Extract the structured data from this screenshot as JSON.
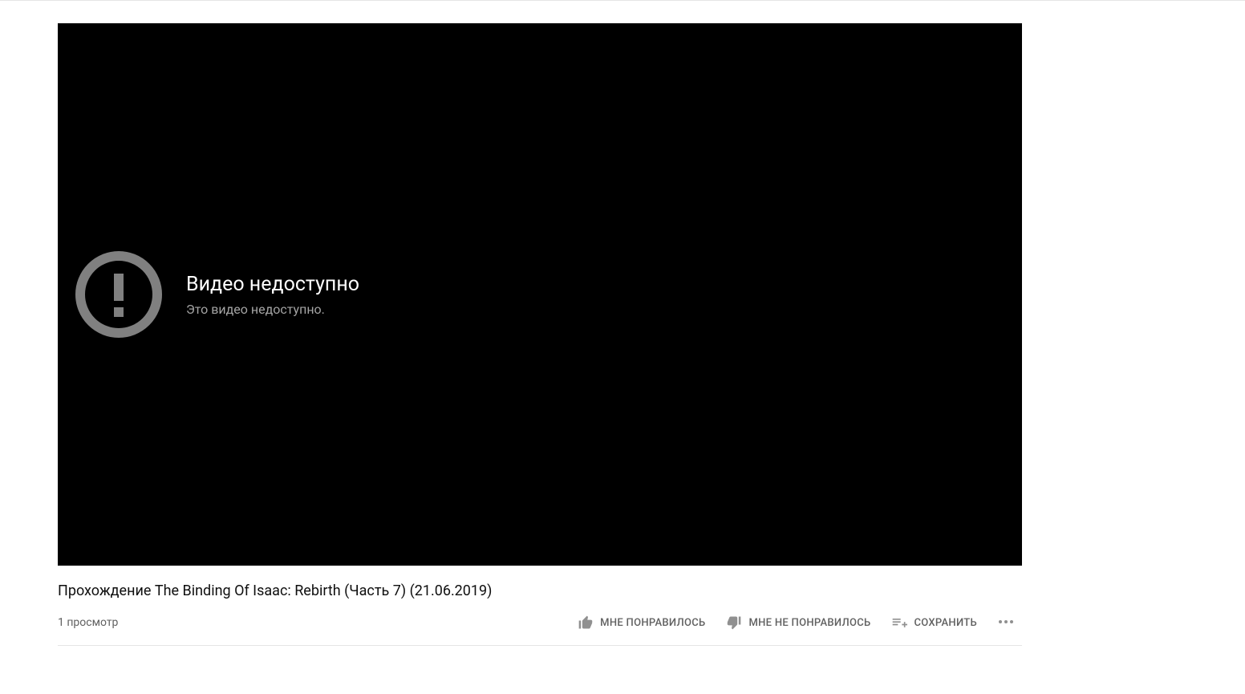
{
  "player": {
    "unavailable_title": "Видео недоступно",
    "unavailable_subtitle": "Это видео недоступно."
  },
  "video": {
    "title": "Прохождение The Binding Of Isaac: Rebirth (Часть 7) (21.06.2019)",
    "views_text": "1 просмотр"
  },
  "actions": {
    "like_label": "МНЕ ПОНРАВИЛОСЬ",
    "dislike_label": "МНЕ НЕ ПОНРАВИЛОСЬ",
    "save_label": "СОХРАНИТЬ"
  }
}
